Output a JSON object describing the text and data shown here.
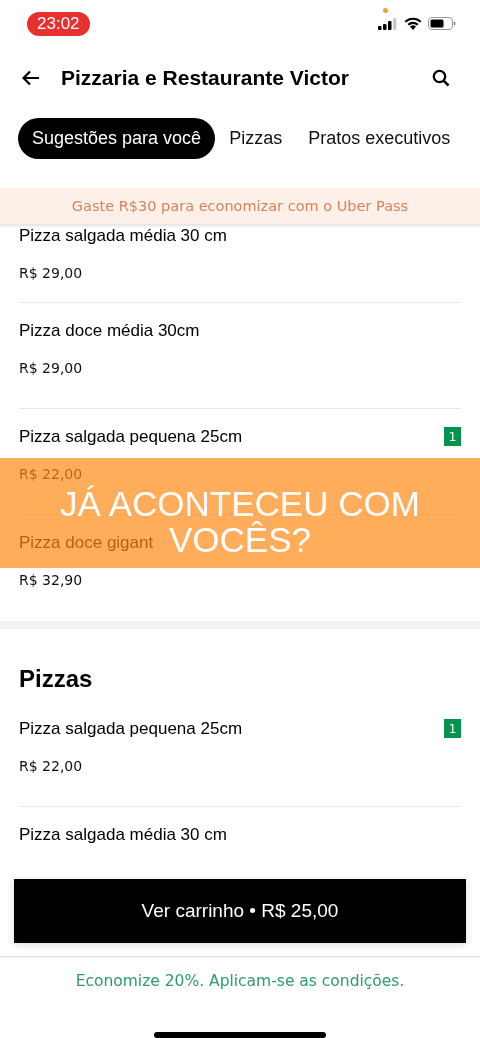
{
  "status_bar": {
    "time": "23:02"
  },
  "header": {
    "title": "Pizzaria e Restaurante Victor"
  },
  "tabs": [
    {
      "label": "Sugestões para você",
      "selected": true
    },
    {
      "label": "Pizzas",
      "selected": false
    },
    {
      "label": "Pratos executivos",
      "selected": false
    }
  ],
  "promo": {
    "text": "Gaste R$30 para economizar com o Uber Pass"
  },
  "sections": [
    {
      "items": [
        {
          "name": "Pizza salgada média 30 cm",
          "price": "R$ 29,00"
        },
        {
          "name": "Pizza doce média 30cm",
          "price": "R$ 29,00"
        },
        {
          "name": "Pizza salgada pequena 25cm",
          "price": "R$ 22,00",
          "quantity": "1"
        },
        {
          "name": "Pizza doce gigant",
          "price": "R$ 32,90"
        }
      ]
    },
    {
      "title": "Pizzas",
      "items": [
        {
          "name": "Pizza salgada pequena 25cm",
          "price": "R$ 22,00",
          "quantity": "1"
        },
        {
          "name": "Pizza salgada média 30 cm"
        }
      ]
    }
  ],
  "caption": {
    "lines": [
      "JÁ ACONTECEU COM",
      "VOCÊS?"
    ]
  },
  "cart_button": {
    "label": "Ver carrinho • R$ 25,00"
  },
  "footer": {
    "text": "Economize 20%. Aplicam-se as condições."
  }
}
